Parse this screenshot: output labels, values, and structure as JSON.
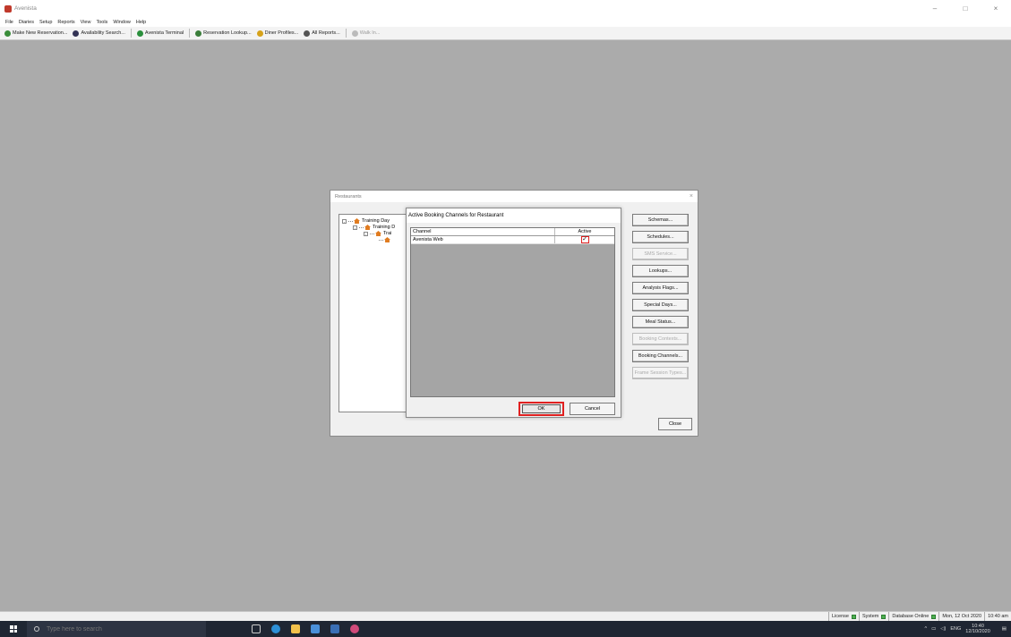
{
  "window": {
    "title": "Avenista",
    "controls": [
      "–",
      "□",
      "×"
    ]
  },
  "menu": [
    "File",
    "Diaries",
    "Setup",
    "Reports",
    "View",
    "Tools",
    "Window",
    "Help"
  ],
  "toolbar": {
    "items": [
      {
        "label": "Make New Reservation...",
        "icon": "booking-icon",
        "color": "#3a8d3a"
      },
      {
        "label": "Availability Search...",
        "icon": "search-icon",
        "color": "#335"
      },
      {
        "label": "Avenista Terminal",
        "icon": "terminal-icon",
        "color": "#2a8f3c"
      },
      {
        "label": "Reservation Lookup...",
        "icon": "lookup-icon",
        "color": "#3a7d3a"
      },
      {
        "label": "Diner Profiles...",
        "icon": "profile-icon",
        "color": "#d6a21a"
      },
      {
        "label": "All Reports...",
        "icon": "reports-icon",
        "color": "#555"
      },
      {
        "label": "Walk In...",
        "icon": "walk-in-icon",
        "color": "#999",
        "disabled": true
      }
    ]
  },
  "restaurants": {
    "title": "Restaurants",
    "tree": [
      {
        "label": "Training Day",
        "level": 0
      },
      {
        "label": "Training D",
        "level": 1
      },
      {
        "label": "Trai",
        "level": 2
      }
    ],
    "buttons": [
      {
        "label": "Schemas...",
        "disabled": false
      },
      {
        "label": "Schedules...",
        "disabled": false
      },
      {
        "label": "SMS Service...",
        "disabled": true
      },
      {
        "label": "Lookups...",
        "disabled": false
      },
      {
        "label": "Analysis Flags...",
        "disabled": false
      },
      {
        "label": "Special Days...",
        "disabled": false
      },
      {
        "label": "Meal Status...",
        "disabled": false
      },
      {
        "label": "Booking Contexts...",
        "disabled": true
      },
      {
        "label": "Booking Channels...",
        "disabled": false
      },
      {
        "label": "Frame Session Types...",
        "disabled": true
      }
    ],
    "close_label": "Close"
  },
  "dialog": {
    "title": "Active Booking Channels for Restaurant",
    "columns": [
      "Channel",
      "Active"
    ],
    "rows": [
      {
        "channel": "Avenista Web",
        "active": true,
        "active_mark": "✓"
      }
    ],
    "ok_label": "OK",
    "cancel_label": "Cancel"
  },
  "status": [
    {
      "label": "License"
    },
    {
      "label": "System"
    },
    {
      "label": "Database Online"
    },
    {
      "label": "Mon, 12 Oct 2020"
    },
    {
      "label": "10:40 am"
    }
  ],
  "taskbar": {
    "search_placeholder": "Type here to search",
    "lang": "ENG",
    "time": "10:40",
    "date": "12/10/2020"
  }
}
